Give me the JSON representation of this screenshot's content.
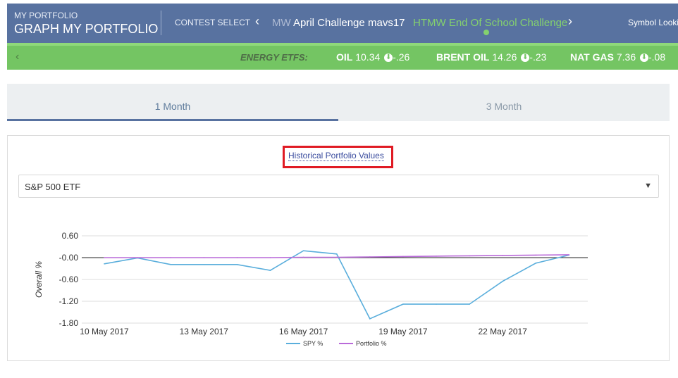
{
  "header": {
    "subtitle": "MY PORTFOLIO",
    "title": "GRAPH MY PORTFOLIO",
    "contest_label": "CONTEST SELECT",
    "nav_left": "‹",
    "nav_right": "›",
    "contests": [
      {
        "prefix": "MW",
        "label": " April Challenge"
      },
      {
        "label": "mavs17"
      },
      {
        "label": "HTMW End Of School Challenge",
        "active": true
      }
    ],
    "symbol_lookup": "Symbol Looki"
  },
  "ticker": {
    "nav_left": "‹",
    "label": "ENERGY ETFS:",
    "items": [
      {
        "name": "OIL",
        "value": "10.34",
        "change": "-.26"
      },
      {
        "name": "BRENT OIL",
        "value": "14.26",
        "change": "-.23"
      },
      {
        "name": "NAT GAS",
        "value": "7.36",
        "change": "-.08"
      }
    ]
  },
  "tabs": [
    {
      "label": "1 Month",
      "active": true
    },
    {
      "label": "3 Month",
      "active": false
    }
  ],
  "panel": {
    "link": "Historical Portfolio Values",
    "select_value": "S&P 500 ETF",
    "select_caret": "▼"
  },
  "chart_data": {
    "type": "line",
    "ylabel": "Overall %",
    "xlabel": "",
    "ylim": [
      -1.8,
      0.6
    ],
    "yticks": [
      0.6,
      0.0,
      -0.6,
      -1.2,
      -1.8
    ],
    "ytick_labels": [
      "0.60",
      "-0.00",
      "-0.60",
      "-1.20",
      "-1.80"
    ],
    "xticks": [
      "10 May 2017",
      "13 May 2017",
      "16 May 2017",
      "19 May 2017",
      "22 May 2017"
    ],
    "x_index_range": [
      0,
      15
    ],
    "series": [
      {
        "name": "SPY %",
        "color": "#5aaedc",
        "x": [
          0,
          1,
          2,
          3,
          4,
          5,
          6,
          7,
          8,
          9,
          10,
          11,
          12,
          13,
          14
        ],
        "values": [
          -0.17,
          -0.01,
          -0.19,
          -0.19,
          -0.19,
          -0.35,
          0.19,
          0.1,
          -1.68,
          -1.28,
          -1.28,
          -1.28,
          -0.65,
          -0.15,
          0.07
        ]
      },
      {
        "name": "Portfolio %",
        "color": "#b96ad9",
        "x": [
          0,
          1,
          2,
          3,
          4,
          5,
          6,
          7,
          8,
          9,
          10,
          11,
          12,
          13,
          14
        ],
        "values": [
          0.0,
          0.0,
          0.0,
          0.0,
          0.0,
          0.0,
          0.01,
          0.01,
          0.02,
          0.03,
          0.04,
          0.05,
          0.06,
          0.07,
          0.08
        ]
      }
    ]
  }
}
